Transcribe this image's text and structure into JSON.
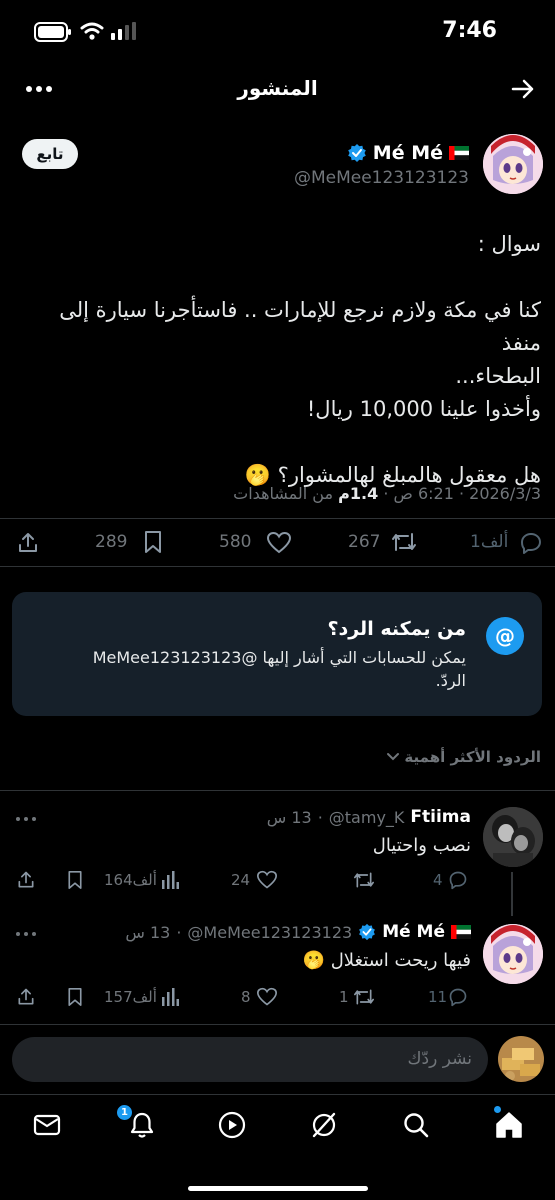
{
  "status_bar": {
    "time": "7:46"
  },
  "header": {
    "title": "المنشور"
  },
  "post": {
    "author_name": "Mé Mé",
    "author_handle": "@MeMee123123123",
    "follow_label": "تابع",
    "text_lines": [
      "سوال :",
      "",
      "كنا في مكة ولازم نرجع للإمارات .. فاستأجرنا سيارة إلى منفذ",
      "البطحاء...",
      "وأخذوا علينا 10,000 ريال!",
      "",
      "هل معقول هالمبلغ لهالمشوار؟ 🫢"
    ],
    "date": "2026/3/3",
    "time": "6:21 ص",
    "views_count": "1.4م",
    "views_label": "من المشاهدات",
    "actions": {
      "replies": "1ألف",
      "reposts": "267",
      "likes": "580",
      "bookmarks": "289"
    }
  },
  "reply_restriction": {
    "title": "من يمكنه الرد؟",
    "line1": "يمكن للحسابات التي أشار إليها @MeMee123123123",
    "line2": "الردّ.",
    "icon": "@"
  },
  "sort": {
    "label": "الردود الأكثر أهمية"
  },
  "replies": [
    {
      "name": "Ftiima",
      "handle": "@tamy_K",
      "time": "13 س",
      "text": "نصب واحتيال",
      "replies": "4",
      "reposts": "",
      "likes": "24",
      "views": "164ألف"
    },
    {
      "name": "Mé Mé",
      "handle": "@MeMee123123123",
      "time": "13 س",
      "text": "فيها ريحت استغلال 🫢",
      "replies": "11",
      "reposts": "1",
      "likes": "8",
      "views": "157ألف"
    }
  ],
  "compose": {
    "placeholder": "نشر ردّك"
  },
  "nav": {
    "notifications_badge": "1"
  },
  "colors": {
    "accent": "#1d9bf0",
    "background": "#000000",
    "card": "#16202a",
    "muted": "#71767b"
  }
}
